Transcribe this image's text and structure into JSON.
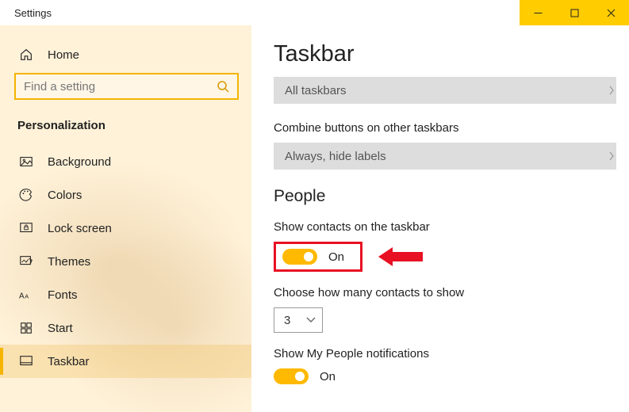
{
  "window": {
    "title": "Settings"
  },
  "home": {
    "label": "Home"
  },
  "search": {
    "placeholder": "Find a setting"
  },
  "section": {
    "title": "Personalization"
  },
  "nav": {
    "items": [
      {
        "label": "Background"
      },
      {
        "label": "Colors"
      },
      {
        "label": "Lock screen"
      },
      {
        "label": "Themes"
      },
      {
        "label": "Fonts"
      },
      {
        "label": "Start"
      },
      {
        "label": "Taskbar"
      }
    ]
  },
  "page": {
    "title": "Taskbar",
    "dropdown1": {
      "label": "All taskbars"
    },
    "combineLabel": "Combine buttons on other taskbars",
    "dropdown2": {
      "label": "Always, hide labels"
    },
    "peopleTitle": "People",
    "showContacts": {
      "label": "Show contacts on the taskbar",
      "state": "On"
    },
    "chooseCount": {
      "label": "Choose how many contacts to show",
      "value": "3"
    },
    "showNotifications": {
      "label": "Show My People notifications",
      "state": "On"
    }
  }
}
